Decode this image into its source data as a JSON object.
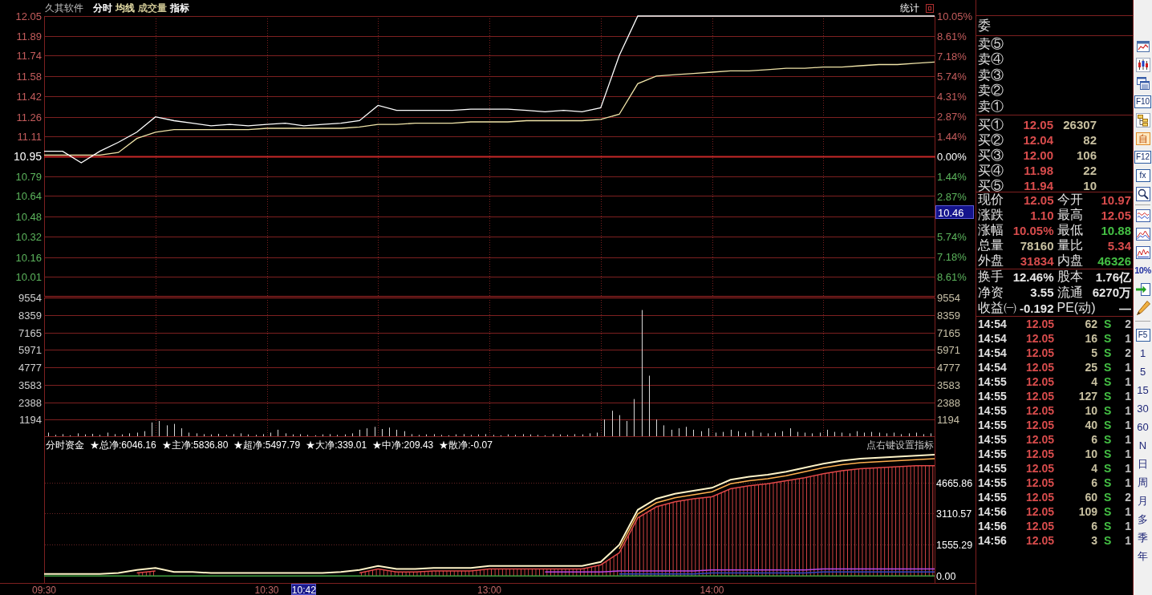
{
  "header": {
    "stock_name": "久其软件",
    "items": [
      {
        "label": "分时",
        "color": "#ffffff"
      },
      {
        "label": "均线",
        "color": "#e8e0a8"
      },
      {
        "label": "成交量",
        "color": "#c8c090"
      },
      {
        "label": "指标",
        "color": "#ffffff"
      }
    ],
    "statistics": "统计"
  },
  "price_chart": {
    "chart_data": {
      "type": "line",
      "grid": true,
      "categories": [
        null,
        null,
        null,
        null,
        null,
        null,
        null,
        null,
        null,
        null,
        null,
        null,
        null,
        null,
        null,
        null,
        null,
        null,
        null,
        null,
        null,
        null,
        null,
        null,
        null,
        null,
        null,
        null,
        null,
        null,
        null,
        null,
        null,
        null,
        null,
        null,
        null,
        null,
        null,
        null,
        null,
        null,
        null,
        null,
        null,
        null,
        null,
        null,
        null
      ],
      "ylim": [
        9.85,
        12.05
      ],
      "yticks": [
        {
          "value": 12.05,
          "label": "12.05"
        },
        {
          "value": 11.89,
          "label": "11.89"
        },
        {
          "value": 11.74,
          "label": "11.74"
        },
        {
          "value": 11.58,
          "label": "11.58"
        },
        {
          "value": 11.42,
          "label": "11.42"
        },
        {
          "value": 11.26,
          "label": "11.26"
        },
        {
          "value": 11.11,
          "label": "11.11"
        },
        {
          "value": 10.95,
          "label": "10.95"
        },
        {
          "value": 10.79,
          "label": "10.79"
        },
        {
          "value": 10.64,
          "label": "10.64"
        },
        {
          "value": 10.48,
          "label": "10.48"
        },
        {
          "value": 10.32,
          "label": "10.32"
        },
        {
          "value": 10.16,
          "label": "10.16"
        },
        {
          "value": 10.01,
          "label": "10.01"
        }
      ],
      "y2lim": [
        -10.05,
        10.05
      ],
      "y2ticks": [
        {
          "value": 10.05,
          "label": "10.05%"
        },
        {
          "value": 8.61,
          "label": "8.61%"
        },
        {
          "value": 7.18,
          "label": "7.18%"
        },
        {
          "value": 5.74,
          "label": "5.74%"
        },
        {
          "value": 4.31,
          "label": "4.31%"
        },
        {
          "value": 2.87,
          "label": "2.87%"
        },
        {
          "value": 1.44,
          "label": "1.44%"
        },
        {
          "value": 0,
          "label": "0.00%"
        },
        {
          "value": -1.44,
          "label": "1.44%"
        },
        {
          "value": -2.87,
          "label": "2.87%"
        },
        {
          "value": -5.74,
          "label": "5.74%"
        },
        {
          "value": -7.18,
          "label": "7.18%"
        },
        {
          "value": -8.61,
          "label": "8.61%"
        }
      ],
      "ref_lines": [
        {
          "axis": "y",
          "value": 10.95
        }
      ],
      "series": [
        {
          "color": "#ffffff",
          "values": [
            10.99,
            10.99,
            10.9,
            10.99,
            11.06,
            11.14,
            11.26,
            11.23,
            11.21,
            11.19,
            11.2,
            11.19,
            11.2,
            11.21,
            11.19,
            11.2,
            11.21,
            11.23,
            11.35,
            11.31,
            11.31,
            11.31,
            11.31,
            11.32,
            11.32,
            11.32,
            11.31,
            11.3,
            11.31,
            11.3,
            11.33,
            11.74,
            12.05,
            12.05,
            12.05,
            12.05,
            12.05,
            12.05,
            12.05,
            12.05,
            12.05,
            12.05,
            12.05,
            12.05,
            12.05,
            12.05,
            12.05,
            12.05,
            12.05
          ]
        },
        {
          "color": "#f0e4a8",
          "values": [
            10.96,
            10.96,
            10.96,
            10.96,
            10.98,
            11.09,
            11.14,
            11.16,
            11.16,
            11.16,
            11.16,
            11.16,
            11.17,
            11.17,
            11.17,
            11.17,
            11.17,
            11.18,
            11.2,
            11.2,
            11.21,
            11.21,
            11.21,
            11.22,
            11.22,
            11.22,
            11.23,
            11.23,
            11.23,
            11.23,
            11.24,
            11.28,
            11.52,
            11.58,
            11.59,
            11.6,
            11.61,
            11.62,
            11.62,
            11.63,
            11.64,
            11.64,
            11.65,
            11.65,
            11.66,
            11.67,
            11.67,
            11.68,
            11.69
          ]
        }
      ],
      "annotations": [
        "10.46"
      ]
    }
  },
  "volume_chart": {
    "chart_data": {
      "type": "bar",
      "grid": true,
      "ylim": [
        0,
        9554
      ],
      "yticks": [
        {
          "value": 9554,
          "label": "9554"
        },
        {
          "value": 8359,
          "label": "8359"
        },
        {
          "value": 7165,
          "label": "7165"
        },
        {
          "value": 5971,
          "label": "5971"
        },
        {
          "value": 4777,
          "label": "4777"
        },
        {
          "value": 3583,
          "label": "3583"
        },
        {
          "value": 2388,
          "label": "2388"
        },
        {
          "value": 1194,
          "label": "1194"
        }
      ],
      "y2lim": [
        0,
        9554
      ],
      "y2ticks": [
        {
          "value": 9554,
          "label": "9554"
        },
        {
          "value": 8359,
          "label": "8359"
        },
        {
          "value": 7165,
          "label": "7165"
        },
        {
          "value": 5971,
          "label": "5971"
        },
        {
          "value": 4777,
          "label": "4777"
        },
        {
          "value": 3583,
          "label": "3583"
        },
        {
          "value": 2388,
          "label": "2388"
        },
        {
          "value": 1194,
          "label": "1194"
        }
      ],
      "values": [
        300,
        150,
        200,
        120,
        250,
        180,
        220,
        150,
        300,
        200,
        180,
        250,
        300,
        400,
        1000,
        1100,
        800,
        900,
        600,
        300,
        250,
        200,
        180,
        220,
        150,
        200,
        250,
        180,
        150,
        200,
        300,
        500,
        250,
        180,
        200,
        150,
        120,
        180,
        200,
        150,
        180,
        250,
        500,
        600,
        700,
        550,
        650,
        500,
        400,
        200,
        150,
        180,
        200,
        150,
        120,
        180,
        200,
        150,
        180,
        200,
        150,
        120,
        180,
        150,
        200,
        180,
        150,
        120,
        200,
        180,
        150,
        200,
        180,
        250,
        300,
        1200,
        1800,
        1500,
        1100,
        2600,
        8700,
        4200,
        1200,
        800,
        500,
        600,
        700,
        500,
        400,
        600,
        300,
        350,
        500,
        400,
        300,
        450,
        300,
        250,
        300,
        400,
        600,
        350,
        300,
        250,
        300,
        500,
        350,
        300,
        250,
        400,
        300,
        350,
        300,
        250,
        300,
        200,
        250,
        300,
        200,
        250
      ]
    }
  },
  "fund_flow": {
    "title": "分时资金",
    "legend": [
      "★总净:6046.16",
      "★主净:5836.80",
      "★超净:5497.79",
      "★大净:339.01",
      "★中净:209.43",
      "★散净:-0.07"
    ],
    "hint": "点右键设置指标",
    "chart_data": {
      "type": "line",
      "grid": true,
      "categories": [
        "09:30",
        null,
        null,
        null,
        null,
        null,
        null,
        null,
        null,
        null,
        null,
        null,
        "10:30",
        null,
        "10:42",
        null,
        null,
        null,
        null,
        null,
        null,
        null,
        null,
        null,
        "13:00",
        null,
        null,
        null,
        null,
        null,
        null,
        null,
        null,
        null,
        null,
        null,
        "14:00",
        null,
        null,
        null,
        null,
        null,
        null,
        null,
        null,
        null,
        null,
        null,
        null
      ],
      "ylim": [
        -350,
        6930
      ],
      "yticks": [
        {
          "value": 0,
          "label": "0.00"
        },
        {
          "value": 1555.29,
          "label": "1555.29"
        },
        {
          "value": 3110.57,
          "label": "3110.57"
        },
        {
          "value": 4665.86,
          "label": "4665.86"
        }
      ],
      "series": [
        {
          "color": "#fff4c8",
          "values": [
            100,
            100,
            100,
            100,
            150,
            300,
            400,
            200,
            200,
            150,
            150,
            150,
            150,
            150,
            150,
            150,
            200,
            300,
            500,
            350,
            350,
            400,
            400,
            400,
            500,
            500,
            500,
            500,
            500,
            500,
            700,
            1550,
            3300,
            3850,
            4100,
            4250,
            4400,
            4800,
            4950,
            5050,
            5200,
            5400,
            5600,
            5750,
            5850,
            5900,
            5950,
            6000,
            6050
          ]
        },
        {
          "color": "#ffb050",
          "values": [
            null,
            null,
            null,
            null,
            null,
            null,
            null,
            null,
            null,
            null,
            null,
            null,
            null,
            null,
            null,
            null,
            null,
            null,
            null,
            null,
            null,
            null,
            null,
            null,
            null,
            null,
            null,
            null,
            null,
            null,
            null,
            1350,
            3100,
            3650,
            3900,
            4050,
            4200,
            4600,
            4750,
            4850,
            5000,
            5200,
            5400,
            5550,
            5650,
            5700,
            5750,
            5800,
            5850
          ]
        },
        {
          "type": "area",
          "color": "#e04848",
          "values": [
            null,
            null,
            null,
            null,
            null,
            150,
            250,
            null,
            null,
            null,
            null,
            null,
            null,
            null,
            null,
            null,
            null,
            150,
            350,
            200,
            200,
            250,
            250,
            250,
            350,
            350,
            350,
            350,
            350,
            350,
            550,
            1150,
            2900,
            3450,
            3700,
            3850,
            3950,
            4350,
            4500,
            4600,
            4750,
            4900,
            5100,
            5250,
            5350,
            5400,
            5450,
            5500,
            5500
          ]
        },
        {
          "color": "#b848e8",
          "values": [
            null,
            null,
            null,
            null,
            null,
            null,
            null,
            null,
            null,
            null,
            null,
            null,
            null,
            null,
            null,
            null,
            null,
            null,
            null,
            null,
            null,
            null,
            null,
            null,
            null,
            null,
            null,
            200,
            200,
            200,
            200,
            250,
            250,
            250,
            250,
            250,
            300,
            300,
            300,
            300,
            300,
            300,
            350,
            350,
            350,
            350,
            350,
            350,
            350
          ]
        },
        {
          "color": "#3048c8",
          "values": [
            null,
            null,
            null,
            null,
            null,
            null,
            null,
            null,
            null,
            null,
            null,
            null,
            null,
            null,
            null,
            null,
            null,
            null,
            null,
            null,
            null,
            null,
            null,
            null,
            null,
            null,
            null,
            null,
            null,
            null,
            null,
            100,
            100,
            100,
            100,
            100,
            150,
            150,
            150,
            150,
            150,
            150,
            200,
            200,
            200,
            200,
            200,
            200,
            200
          ]
        },
        {
          "color": "#40a040",
          "values": [
            0,
            0,
            0,
            0,
            0,
            0,
            0,
            0,
            0,
            0,
            0,
            0,
            0,
            0,
            0,
            0,
            0,
            0,
            0,
            0,
            0,
            0,
            0,
            0,
            0,
            0,
            0,
            0,
            0,
            0,
            0,
            0,
            0,
            0,
            0,
            0,
            0,
            0,
            0,
            0,
            0,
            0,
            0,
            0,
            0,
            0,
            0,
            0,
            0
          ]
        }
      ],
      "annotations": [
        {
          "x": "10:42"
        }
      ]
    }
  },
  "quote_panel": {
    "order_ratio_label": "委",
    "asks": [
      "卖⑤",
      "卖④",
      "卖③",
      "卖②",
      "卖①"
    ],
    "bids": [
      {
        "label": "买①",
        "price": "12.05",
        "volume": "26307"
      },
      {
        "label": "买②",
        "price": "12.04",
        "volume": "82"
      },
      {
        "label": "买③",
        "price": "12.00",
        "volume": "106"
      },
      {
        "label": "买④",
        "price": "11.98",
        "volume": "22"
      },
      {
        "label": "买⑤",
        "price": "11.94",
        "volume": "10"
      }
    ],
    "stats": [
      {
        "label": "现价",
        "value": "12.05",
        "color": "#d84c4c"
      },
      {
        "label": "今开",
        "value": "10.97",
        "color": "#d84c4c"
      },
      {
        "label": "涨跌",
        "value": "1.10",
        "color": "#d84c4c"
      },
      {
        "label": "最高",
        "value": "12.05",
        "color": "#d84c4c"
      },
      {
        "label": "涨幅",
        "value": "10.05%",
        "color": "#d84c4c"
      },
      {
        "label": "最低",
        "value": "10.88",
        "color": "#44c044"
      },
      {
        "label": "总量",
        "value": "78160",
        "color": "#c8c0a0"
      },
      {
        "label": "量比",
        "value": "5.34",
        "color": "#d84c4c"
      },
      {
        "label": "外盘",
        "value": "31834",
        "color": "#d84c4c"
      },
      {
        "label": "内盘",
        "value": "46326",
        "color": "#44c044"
      }
    ],
    "fundamentals": [
      {
        "label": "换手",
        "value": "12.46%"
      },
      {
        "label": "股本",
        "value": "1.76亿"
      },
      {
        "label": "净资",
        "value": "3.55"
      },
      {
        "label": "流通",
        "value": "6270万"
      },
      {
        "label": "收益㈠",
        "value": "-0.192"
      },
      {
        "label": "PE(动)",
        "value": "—"
      }
    ],
    "trades": [
      {
        "time": "14:54",
        "price": "12.05",
        "volume": "62",
        "side": "S",
        "column_5": "2"
      },
      {
        "time": "14:54",
        "price": "12.05",
        "volume": "16",
        "side": "S",
        "column_5": "1"
      },
      {
        "time": "14:54",
        "price": "12.05",
        "volume": "5",
        "side": "S",
        "column_5": "2"
      },
      {
        "time": "14:54",
        "price": "12.05",
        "volume": "25",
        "side": "S",
        "column_5": "1"
      },
      {
        "time": "14:55",
        "price": "12.05",
        "volume": "4",
        "side": "S",
        "column_5": "1"
      },
      {
        "time": "14:55",
        "price": "12.05",
        "volume": "127",
        "side": "S",
        "column_5": "1"
      },
      {
        "time": "14:55",
        "price": "12.05",
        "volume": "10",
        "side": "S",
        "column_5": "1"
      },
      {
        "time": "14:55",
        "price": "12.05",
        "volume": "40",
        "side": "S",
        "column_5": "1"
      },
      {
        "time": "14:55",
        "price": "12.05",
        "volume": "6",
        "side": "S",
        "column_5": "1"
      },
      {
        "time": "14:55",
        "price": "12.05",
        "volume": "10",
        "side": "S",
        "column_5": "1"
      },
      {
        "time": "14:55",
        "price": "12.05",
        "volume": "4",
        "side": "S",
        "column_5": "1"
      },
      {
        "time": "14:55",
        "price": "12.05",
        "volume": "6",
        "side": "S",
        "column_5": "1"
      },
      {
        "time": "14:55",
        "price": "12.05",
        "volume": "60",
        "side": "S",
        "column_5": "2"
      },
      {
        "time": "14:56",
        "price": "12.05",
        "volume": "109",
        "side": "S",
        "column_5": "1"
      },
      {
        "time": "14:56",
        "price": "12.05",
        "volume": "6",
        "side": "S",
        "column_5": "1"
      },
      {
        "time": "14:56",
        "price": "12.05",
        "volume": "3",
        "side": "S",
        "column_5": "1"
      }
    ]
  },
  "toolbar": [
    {
      "label": "F10",
      "kind": "boxed"
    },
    {
      "label": "自",
      "kind": "tinted"
    },
    {
      "label": "F12",
      "kind": "boxed"
    },
    {
      "label": "fx",
      "kind": "boxed"
    },
    {
      "label": "10%",
      "kind": "small"
    },
    {
      "label": "F5",
      "kind": "boxed"
    },
    {
      "label": "1",
      "kind": "plain"
    },
    {
      "label": "5",
      "kind": "plain"
    },
    {
      "label": "15",
      "kind": "plain"
    },
    {
      "label": "30",
      "kind": "plain"
    },
    {
      "label": "60",
      "kind": "plain"
    },
    {
      "label": "N",
      "kind": "plain"
    },
    {
      "label": "日",
      "kind": "plain"
    },
    {
      "label": "周",
      "kind": "plain"
    },
    {
      "label": "月",
      "kind": "plain"
    },
    {
      "label": "多",
      "kind": "plain"
    },
    {
      "label": "季",
      "kind": "plain"
    },
    {
      "label": "年",
      "kind": "plain"
    }
  ]
}
